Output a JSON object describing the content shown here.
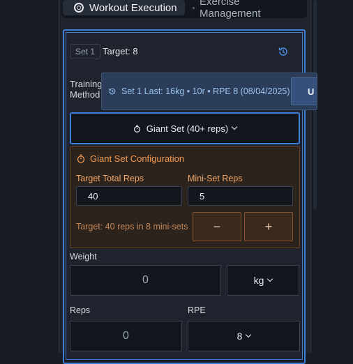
{
  "tabs": {
    "active_label": "Workout Execution",
    "inactive_label": "Exercise Management"
  },
  "set": {
    "badge": "Set 1",
    "target": "Target: 8"
  },
  "training_method": {
    "label": "Training Method",
    "selected": "Giant Set (40+ reps)"
  },
  "tooltip": {
    "text": "Set 1 Last: 16kg • 10r • RPE 8 (08/04/2025)",
    "button_label": "U"
  },
  "giant_set": {
    "title": "Giant Set Configuration",
    "target_total_reps_label": "Target Total Reps",
    "target_total_reps_value": "40",
    "mini_set_reps_label": "Mini-Set Reps",
    "mini_set_reps_value": "5",
    "hint": "Target: 40 reps in 8 mini-sets",
    "decrement_label": "−",
    "increment_label": "+"
  },
  "weight": {
    "label": "Weight",
    "value": "0",
    "unit": "kg"
  },
  "reps": {
    "label": "Reps",
    "value": "0"
  },
  "rpe": {
    "label": "RPE",
    "value": "8"
  },
  "colors": {
    "accent_blue": "#3d7fd8",
    "giant_orange": "#f19a53"
  }
}
